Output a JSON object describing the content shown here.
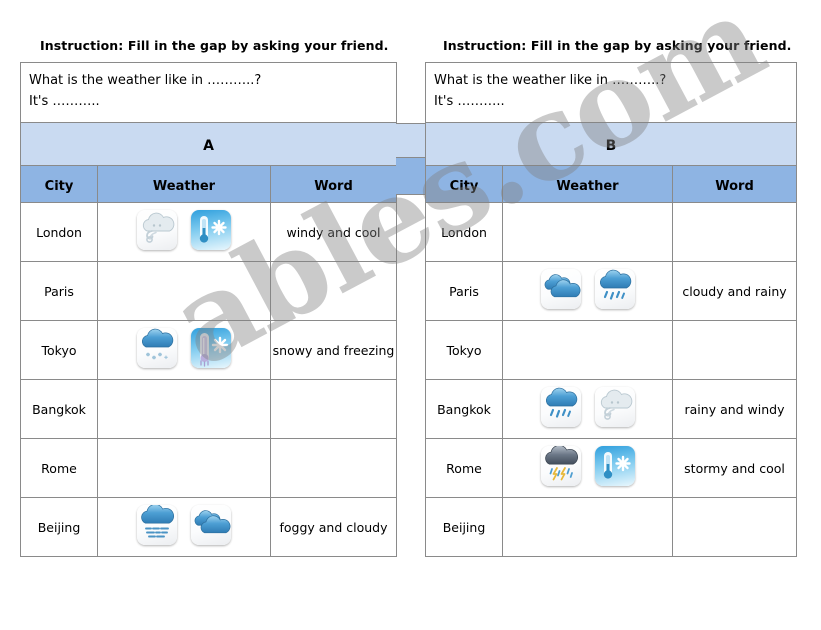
{
  "page": {
    "watermark_text": "ables.com",
    "accent_band_color": "#c9daf1",
    "accent_header_color": "#8eb4e3",
    "border_color": "#8a8a8a"
  },
  "worksheets": [
    {
      "id": "A",
      "instruction": "Instruction: Fill in the gap by asking your friend.",
      "question_line1": "What is the weather like in ………..?",
      "question_line2": "It's ………..",
      "band_label": "A",
      "columns": [
        "City",
        "Weather",
        "Word"
      ],
      "rows": [
        {
          "city": "London",
          "icons": [
            "windy-icon",
            "thermometer-cool-icon"
          ],
          "word": "windy and cool"
        },
        {
          "city": "Paris",
          "icons": [],
          "word": ""
        },
        {
          "city": "Tokyo",
          "icons": [
            "snowy-icon",
            "thermometer-freezing-icon"
          ],
          "word": "snowy and freezing"
        },
        {
          "city": "Bangkok",
          "icons": [],
          "word": ""
        },
        {
          "city": "Rome",
          "icons": [],
          "word": ""
        },
        {
          "city": "Beijing",
          "icons": [
            "foggy-icon",
            "cloudy-icon"
          ],
          "word": "foggy and cloudy"
        }
      ]
    },
    {
      "id": "B",
      "instruction": "Instruction: Fill in the gap by asking your friend.",
      "question_line1": "What is the weather like in ………..?",
      "question_line2": "It's ………..",
      "band_label": "B",
      "columns": [
        "City",
        "Weather",
        "Word"
      ],
      "rows": [
        {
          "city": "London",
          "icons": [],
          "word": ""
        },
        {
          "city": "Paris",
          "icons": [
            "cloudy-icon",
            "rainy-icon"
          ],
          "word": "cloudy and rainy"
        },
        {
          "city": "Tokyo",
          "icons": [],
          "word": ""
        },
        {
          "city": "Bangkok",
          "icons": [
            "rainy-icon",
            "windy-icon"
          ],
          "word": "rainy and windy"
        },
        {
          "city": "Rome",
          "icons": [
            "stormy-icon",
            "thermometer-cool-icon"
          ],
          "word": "stormy and cool"
        },
        {
          "city": "Beijing",
          "icons": [],
          "word": ""
        }
      ]
    }
  ]
}
